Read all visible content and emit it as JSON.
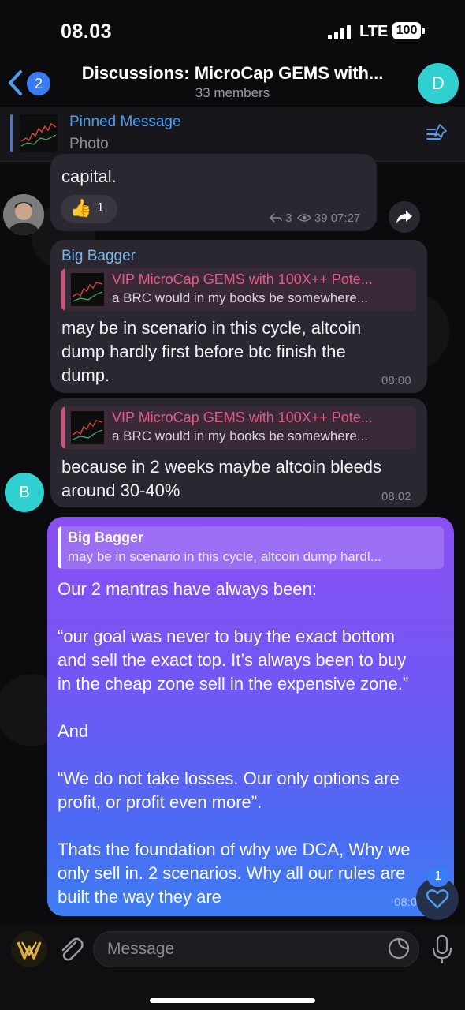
{
  "status_bar": {
    "time": "08.03",
    "network": "LTE",
    "battery": "100"
  },
  "header": {
    "back_badge": "2",
    "title": "Discussions: MicroCap GEMS with...",
    "subtitle": "33 members",
    "avatar_letter": "D"
  },
  "pinned": {
    "title": "Pinned Message",
    "subtitle": "Photo"
  },
  "messages": [
    {
      "text_lines": [
        "capital."
      ],
      "reaction": {
        "emoji": "👍",
        "count": "1"
      },
      "replies": "3",
      "views": "39",
      "time": "07:27"
    },
    {
      "sender": "Big Bagger",
      "reply": {
        "title": "VIP MicroCap GEMS with 100X++ Pote...",
        "text": "a BRC would in my books be somewhere..."
      },
      "text_lines": [
        "may be in scenario in this cycle, altcoin",
        "dump hardly first before btc finish the",
        "dump."
      ],
      "time": "08:00"
    },
    {
      "reply": {
        "title": "VIP MicroCap GEMS with 100X++ Pote...",
        "text": "a BRC would in my books be somewhere..."
      },
      "text_lines": [
        "because in 2 weeks maybe altcoin bleeds",
        "around 30-40%"
      ],
      "time": "08:02",
      "avatar_letter": "B"
    }
  ],
  "outgoing": {
    "reply": {
      "title": "Big Bagger",
      "text": "may be in scenario in this cycle, altcoin dump hardl..."
    },
    "lines": [
      "Our 2 mantras have always been:",
      "",
      "“our goal was never to buy the exact bottom",
      "and sell the exact top. It’s always been to buy",
      "in the cheap zone sell in the expensive zone.”",
      "",
      "And",
      "",
      "“We do not take losses. Our only options are",
      "profit, or profit even more”.",
      "",
      "Thats the foundation of why we DCA, Why we",
      "only sell in. 2 scenarios.  Why all our rules are",
      "built the way they are"
    ],
    "time": "08:0"
  },
  "reactions_badge": "1",
  "input": {
    "placeholder": "Message"
  },
  "colors": {
    "accent": "#3a7bf6",
    "sender": "#7ab6e8",
    "reply_title": "#e05b87",
    "avatar": "#2fd0cf"
  }
}
